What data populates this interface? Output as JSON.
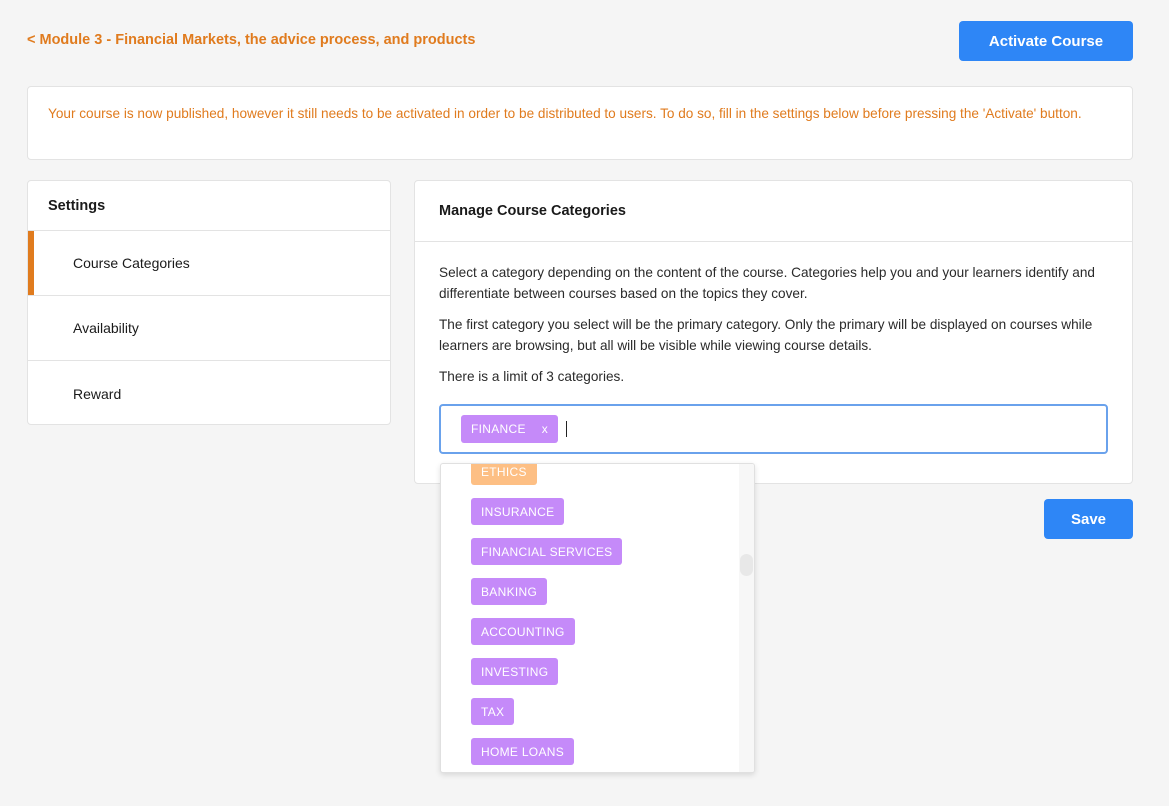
{
  "header": {
    "back_link": "< Module 3 - Financial Markets, the advice process, and products",
    "activate_label": "Activate Course"
  },
  "notice": {
    "text": "Your course is now published, however it still needs to be activated in order to be distributed to users. To do so, fill in the settings below before pressing the 'Activate' button."
  },
  "settings": {
    "title": "Settings",
    "items": [
      {
        "label": "Course Categories",
        "active": true
      },
      {
        "label": "Availability",
        "active": false
      },
      {
        "label": "Reward",
        "active": false
      }
    ]
  },
  "panel": {
    "title": "Manage Course Categories",
    "paragraphs": [
      "Select a category depending on the content of the course. Categories help you and your learners identify and differentiate between courses based on the topics they cover.",
      "The first category you select will be the primary category. Only the primary will be displayed on courses while learners are browsing, but all will be visible while viewing course details.",
      "There is a limit of 3 categories."
    ],
    "selected_chip": "FINANCE",
    "chip_remove": "x",
    "save_label": "Save"
  },
  "dropdown": {
    "options": [
      {
        "label": "ETHICS",
        "color": "#fdbf84"
      },
      {
        "label": "INSURANCE",
        "color": "#c58af9"
      },
      {
        "label": "FINANCIAL SERVICES",
        "color": "#c58af9"
      },
      {
        "label": "BANKING",
        "color": "#c58af9"
      },
      {
        "label": "ACCOUNTING",
        "color": "#c58af9"
      },
      {
        "label": "INVESTING",
        "color": "#c58af9"
      },
      {
        "label": "TAX",
        "color": "#c58af9"
      },
      {
        "label": "HOME LOANS",
        "color": "#c58af9"
      }
    ]
  },
  "colors": {
    "accent_orange": "#e07b1e",
    "primary_blue": "#2e86f6",
    "chip_purple": "#c58af9"
  }
}
